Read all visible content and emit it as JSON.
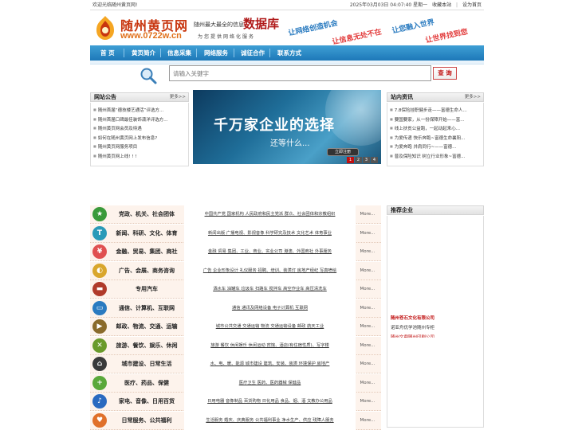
{
  "topbar": {
    "welcome": "欢迎光临随州黄页网!",
    "datetime": "2025年03月03日 04:07:40 星期一",
    "bookmark": "收藏本站",
    "set_home": "设为首页"
  },
  "header": {
    "logo_title": "随州黄页网",
    "logo_url": "www.0722w.cn",
    "slogan_prefix": "随州最大最全的信息",
    "slogan_big": "数据库",
    "slogan_sub": "为您提供网络化服务",
    "ad_words": [
      "让网络创造机会",
      "让信息无处不在",
      "让您融入世界",
      "让世界找到您"
    ]
  },
  "nav": {
    "items": [
      {
        "label": "首 页"
      },
      {
        "label": "黄页简介"
      },
      {
        "label": "信息采集"
      },
      {
        "label": "网络服务"
      },
      {
        "label": "诚征合作"
      },
      {
        "label": "联系方式"
      }
    ]
  },
  "search": {
    "placeholder": "请输入关键字",
    "button": "查 询"
  },
  "notice": {
    "title": "网站公告",
    "more": "更多>>",
    "items": [
      "随州首届“德技楼艺通活”评选方...",
      "随州首届口碑最佳装饰潇洋评选方...",
      "随州黄页网会员及待遇",
      "如何在随州黄页网上发布信息?",
      "随州黄页网服务项目",
      "随州黄页网上线! ! !"
    ]
  },
  "news": {
    "title": "站内资讯",
    "more": "更多>>",
    "items": [
      "7.8保险挂职健步走——富德生命人...",
      "要国要家，从一份保障开始——富...",
      "线上扶贫公益跑，一起动起来心...",
      "为爱传递 快乐奔跑~富德生命襄阳...",
      "为爱奔跑 并肩同行~——富德...",
      "普及保险知识 树立行业形象~富德..."
    ]
  },
  "banner": {
    "headline": "千万家企业的选择",
    "sub": "还等什么...",
    "button": "立即注册",
    "pages": [
      "1",
      "2",
      "3",
      "4"
    ]
  },
  "categories": [
    {
      "name": "党政、机关、社会团体",
      "links": "中国共产党 国家机构 人民政府和民主党派 群众、社会团体和宗教组织",
      "more": "More..."
    },
    {
      "name": "新闻、科研、文化、体育",
      "links": "新闻出版 广播电视、影视音像 科学研究及技术 文化艺术 体育事业",
      "more": "More..."
    },
    {
      "name": "金融、贸易、集团、商社",
      "links": "金融 贸易 集团、工业、商业、实业公司 港澳、外国商社 外事服务",
      "more": "More..."
    },
    {
      "name": "广告、会展、商务咨询",
      "links": "广告 企业形象设计 礼仪服务 招聘、培训、装潢灯 房地产经纪 写真喷绘",
      "more": "More..."
    },
    {
      "name": "专用汽车",
      "links": "洒水车 油罐车 垃圾车 扫路车 搅拌车 高空作业车 高压清洗车",
      "more": "More..."
    },
    {
      "name": "通信、计算机、互联网",
      "links": "通信 通讯及网络设备 电子计算机 互联网",
      "more": "More..."
    },
    {
      "name": "邮政、物流、交通、运输",
      "links": "城市公共交通 交通运输 物流 交通运输设备 邮政 航天工业",
      "more": "More..."
    },
    {
      "name": "旅游、餐饮、娱乐、休闲",
      "links": "旅游 餐饮 休闲娱乐 休闲运动 宾馆、酒店(有住宿性质)、写字楼",
      "more": "More..."
    },
    {
      "name": "城市建设、日常生活",
      "links": "水、电、暖、能源 城市建设 建筑、安装、装潢 环境保护 房地产",
      "more": "More..."
    },
    {
      "name": "医疗、药品、保健",
      "links": "医疗卫生 医药、医药器械 保健品",
      "more": "More..."
    },
    {
      "name": "家电、音像、日用百货",
      "links": "日用电器 音像制品 百货购物 日化用品 食品、烟、酒 文教办公用品",
      "more": "More..."
    },
    {
      "name": "日常服务、公共福利",
      "links": "生活服务 婚庆、庆典服务 公共福利事业 净水生产、供应 残障人服务",
      "more": "More..."
    }
  ],
  "recommend": {
    "title": "推荐企业",
    "items": [
      "随州苍石文化有限公司",
      "诺亚舟优学池随州专柜",
      "随州文鼎随州印刷公司"
    ]
  },
  "colors": {
    "nav_blue": "#2a8ac8",
    "brand_red": "#c8360f",
    "category_bg": "#fdf3ec"
  }
}
